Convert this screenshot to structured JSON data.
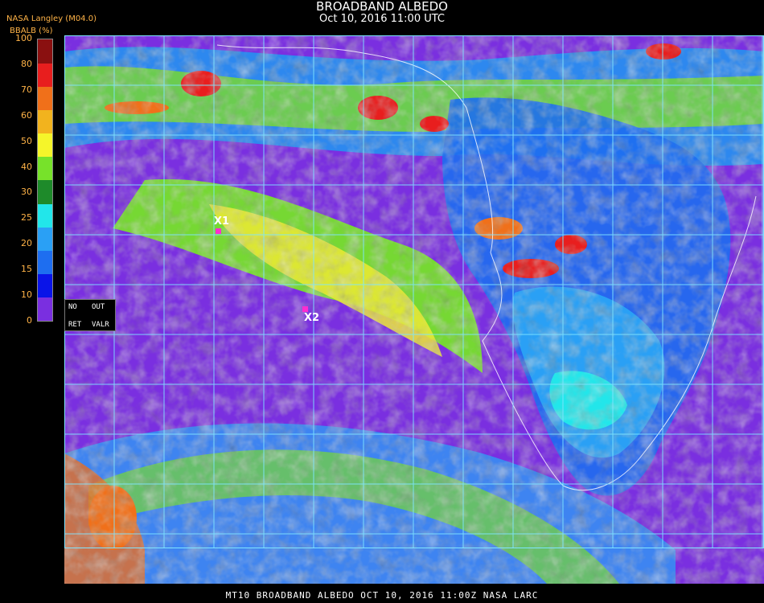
{
  "header": {
    "title": "BROADBAND ALBEDO",
    "subtitle": "Oct 10, 2016 11:00 UTC",
    "source": "NASA Langley (M04.0)"
  },
  "colorbar": {
    "label": "BBALB (%)",
    "ticks": [
      "100",
      "80",
      "70",
      "60",
      "50",
      "40",
      "30",
      "25",
      "20",
      "15",
      "10",
      "0"
    ],
    "bins": [
      {
        "from": 0,
        "to": 10,
        "color": "#7a2fe0"
      },
      {
        "from": 10,
        "to": 15,
        "color": "#0a14e8"
      },
      {
        "from": 15,
        "to": 20,
        "color": "#1e6ef0"
      },
      {
        "from": 20,
        "to": 25,
        "color": "#2aa0f5"
      },
      {
        "from": 25,
        "to": 30,
        "color": "#22e6ea"
      },
      {
        "from": 30,
        "to": 40,
        "color": "#1e8a2a"
      },
      {
        "from": 40,
        "to": 50,
        "color": "#77e22a"
      },
      {
        "from": 50,
        "to": 60,
        "color": "#f5f52a"
      },
      {
        "from": 60,
        "to": 70,
        "color": "#f2b31e"
      },
      {
        "from": 70,
        "to": 80,
        "color": "#f0701a"
      },
      {
        "from": 80,
        "to": 90,
        "color": "#e81e1e"
      },
      {
        "from": 90,
        "to": 100,
        "color": "#8a1010"
      }
    ]
  },
  "legend_box": {
    "no": "NO",
    "out": "OUT",
    "ret": "RET",
    "valr": "VALR"
  },
  "markers": [
    {
      "label": "X1"
    },
    {
      "label": "X2"
    }
  ],
  "footer": "MT10  BROADBAND ALBEDO  OCT 10, 2016 11:00Z  NASA LARC"
}
